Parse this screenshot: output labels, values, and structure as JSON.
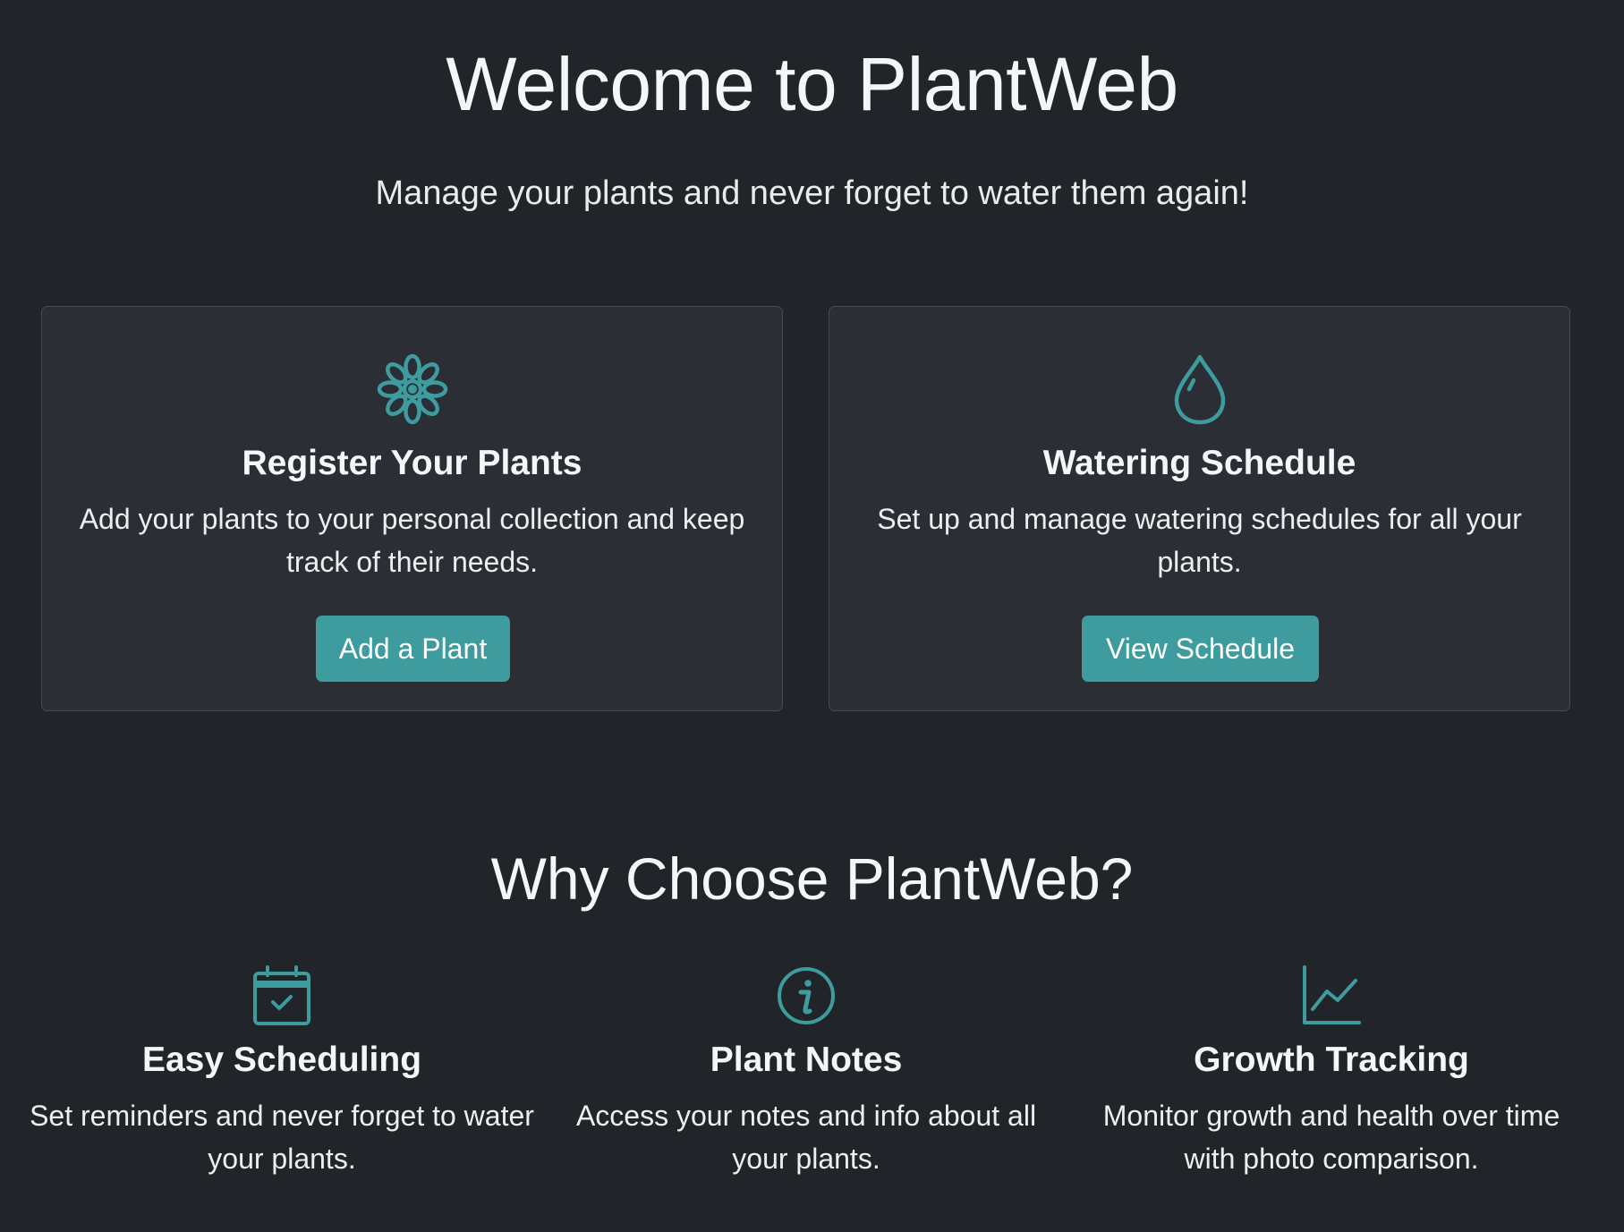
{
  "hero": {
    "title": "Welcome to PlantWeb",
    "subtitle": "Manage your plants and never forget to water them again!"
  },
  "cards": [
    {
      "icon": "flower-icon",
      "title": "Register Your Plants",
      "description": "Add your plants to your personal collection and keep track of their needs.",
      "button_label": "Add a Plant"
    },
    {
      "icon": "water-drop-icon",
      "title": "Watering Schedule",
      "description": "Set up and manage watering schedules for all your plants.",
      "button_label": "View Schedule"
    }
  ],
  "why": {
    "title": "Why Choose PlantWeb?",
    "features": [
      {
        "icon": "calendar-check-icon",
        "title": "Easy Scheduling",
        "description": "Set reminders and never forget to water your plants."
      },
      {
        "icon": "info-circle-icon",
        "title": "Plant Notes",
        "description": "Access your notes and info about all your plants."
      },
      {
        "icon": "graph-up-icon",
        "title": "Growth Tracking",
        "description": "Monitor growth and health over time with photo comparison."
      }
    ]
  },
  "colors": {
    "background": "#212429",
    "card_background": "#2b2e34",
    "card_border": "#464a51",
    "accent": "#3e9c9e",
    "text": "#f5f6f7"
  }
}
